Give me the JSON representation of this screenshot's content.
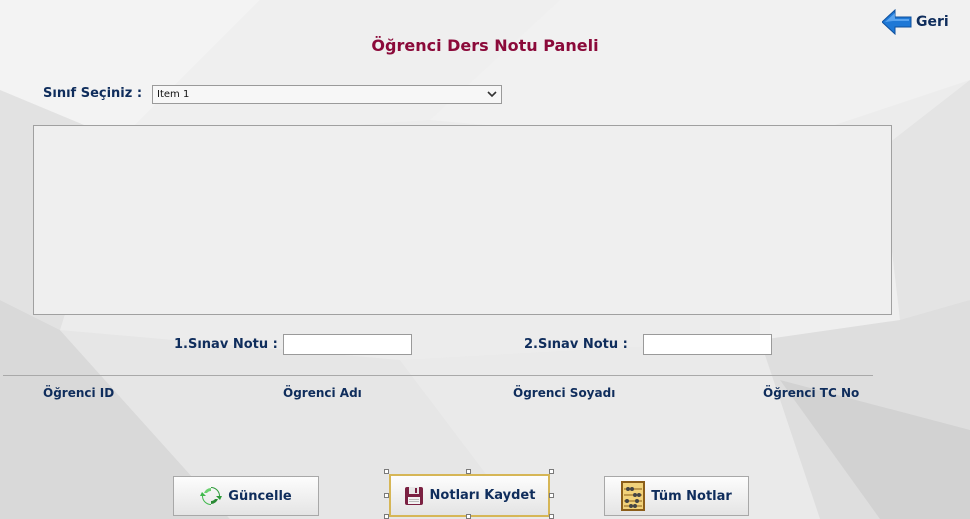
{
  "header": {
    "title": "Öğrenci Ders Notu Paneli",
    "back_label": "Geri"
  },
  "class_select": {
    "label": "Sınıf Seçiniz :",
    "selected": "Item 1"
  },
  "exams": {
    "exam1_label": "1.Sınav Notu :",
    "exam1_value": "",
    "exam2_label": "2.Sınav Notu :",
    "exam2_value": ""
  },
  "student_fields": {
    "id_label": "Öğrenci ID",
    "name_label": "Ögrenci Adı",
    "surname_label": "Ögrenci Soyadı",
    "tc_label": "Öğrenci TC No"
  },
  "buttons": {
    "update_label": "Güncelle",
    "save_label": "Notları Kaydet",
    "all_label": "Tüm Notlar"
  },
  "colors": {
    "title": "#8b0a3a",
    "label": "#0f2d5c",
    "back_arrow": "#1e78d6",
    "selection_outline": "#d6b656"
  },
  "icons": {
    "back": "left-arrow-icon",
    "update": "refresh-icon",
    "save": "floppy-disk-icon",
    "all": "abacus-icon"
  }
}
